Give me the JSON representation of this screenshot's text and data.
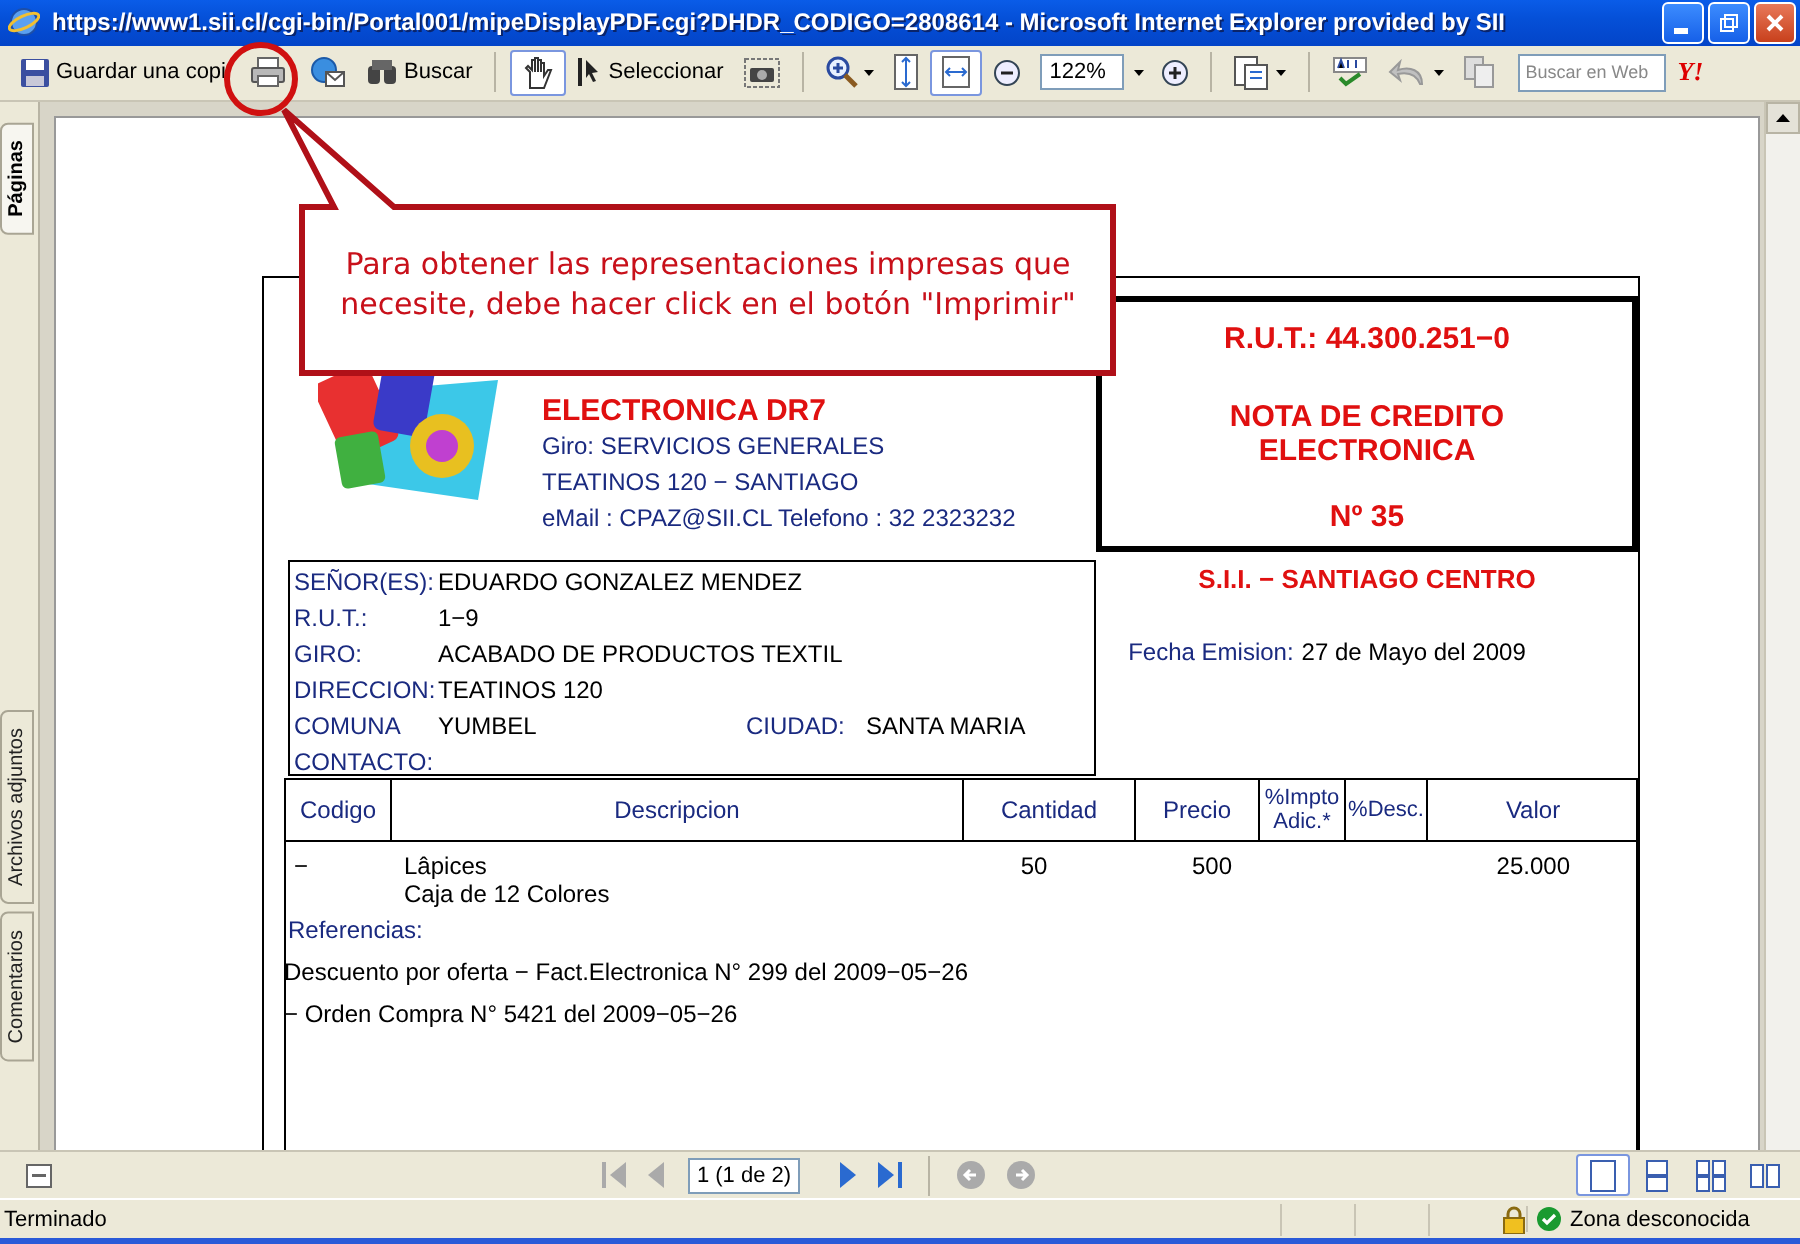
{
  "window": {
    "title": "https://www1.sii.cl/cgi-bin/Portal001/mipeDisplayPDF.cgi?DHDR_CODIGO=2808614 - Microsoft Internet Explorer provided by SII"
  },
  "toolbar": {
    "save_label": "Guardar una copi",
    "find_label": "Buscar",
    "select_label": "Seleccionar",
    "zoom_value": "122%",
    "search_placeholder": "Buscar en Web",
    "yahoo_logo": "Y!",
    "hand_tool_pressed": true,
    "fit_width_pressed": true
  },
  "side_tabs": [
    {
      "label": "Páginas",
      "selected": true
    },
    {
      "label": "Archivos adjuntos",
      "selected": false
    },
    {
      "label": "Comentarios",
      "selected": false
    }
  ],
  "callout": {
    "text": "Para obtener las representaciones impresas que necesite, debe hacer click en el botón \"Imprimir\"",
    "circle_on_print": true
  },
  "invoice": {
    "issuer": {
      "name": "ELECTRONICA DR7",
      "lines": [
        "Giro: SERVICIOS GENERALES",
        "TEATINOS 120 − SANTIAGO",
        "eMail : CPAZ@SII.CL Telefono : 32 2323232"
      ]
    },
    "document_box": {
      "rut": "R.U.T.: 44.300.251−0",
      "type": "NOTA DE CREDITO ELECTRONICA",
      "number": "Nº 35"
    },
    "office": "S.I.I. − SANTIAGO CENTRO",
    "issue_date": {
      "label": "Fecha Emision:",
      "value": "27 de Mayo del 2009"
    },
    "client": [
      {
        "label": "SEÑOR(ES):",
        "value": "EDUARDO GONZALEZ MENDEZ"
      },
      {
        "label": "R.U.T.:",
        "value": "1−9"
      },
      {
        "label": "GIRO:",
        "value": "ACABADO DE PRODUCTOS TEXTIL"
      },
      {
        "label": "DIRECCION:",
        "value": "TEATINOS 120"
      },
      {
        "label": "COMUNA",
        "value": "YUMBEL",
        "label_2": "CIUDAD:",
        "value_2": "SANTA MARIA"
      },
      {
        "label": "CONTACTO:"
      }
    ],
    "table": {
      "columns": [
        "Codigo",
        "Descripcion",
        "Cantidad",
        "Precio",
        "%Impto Adic.*",
        "%Desc.",
        "Valor"
      ],
      "rows": [
        {
          "code": "−",
          "description": [
            "Lâpices",
            "Caja de 12 Colores"
          ],
          "quantity": "50",
          "price": "500",
          "value": "25.000"
        }
      ]
    },
    "references": {
      "label": "Referencias:",
      "lines": [
        "Descuento por oferta − Fact.Electronica N° 299 del 2009−05−26",
        "− Orden Compra N° 5421 del 2009−05−26"
      ]
    }
  },
  "navigation": {
    "page_field": "1 (1 de 2)",
    "buttons": [
      {
        "disabled": true
      },
      {
        "disabled": true
      },
      {
        "disabled": false
      },
      {
        "disabled": false
      },
      {
        "disabled": true
      },
      {
        "disabled": true
      }
    ],
    "views": [
      {
        "selected": true
      },
      {
        "selected": false
      },
      {
        "selected": false
      },
      {
        "selected": false
      }
    ]
  },
  "status_bar": {
    "text": "Terminado",
    "zone": "Zona desconocida"
  }
}
